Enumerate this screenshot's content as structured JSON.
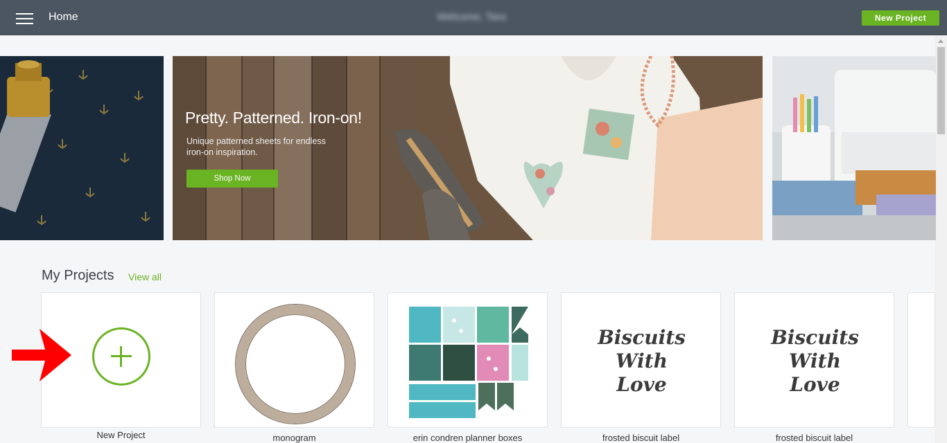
{
  "header": {
    "menu_icon": "hamburger-menu-icon",
    "title": "Home",
    "welcome": "Welcome, Tara",
    "new_project_label": "New Project"
  },
  "banner": {
    "title": "Pretty. Patterned. Iron-on!",
    "subtitle_line1": "Unique patterned sheets for endless",
    "subtitle_line2": "iron-on inspiration.",
    "button_label": "Shop Now"
  },
  "projects": {
    "heading": "My Projects",
    "view_all": "View all",
    "items": [
      {
        "label": "New Project",
        "icon": "plus-icon"
      },
      {
        "label": "monogram"
      },
      {
        "label": "erin condren planner boxes"
      },
      {
        "label": "frosted biscuit label",
        "art_line1": "Biscuits",
        "art_line2": "With",
        "art_line3": "Love"
      },
      {
        "label": "frosted biscuit label",
        "art_line1": "Biscuits",
        "art_line2": "With",
        "art_line3": "Love"
      }
    ]
  },
  "colors": {
    "topbar": "#4b5661",
    "accent_green": "#6ab322",
    "page_bg": "#f5f6f8",
    "annotation_arrow": "#ff0000"
  }
}
